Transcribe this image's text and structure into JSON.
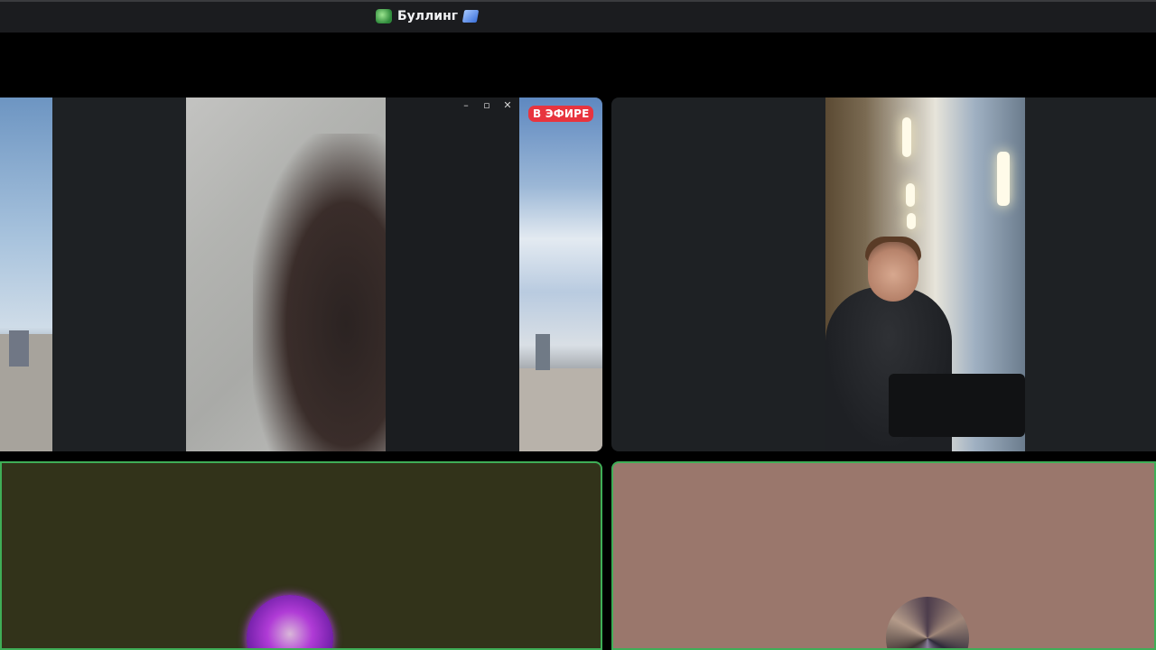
{
  "window": {
    "title": "Буллинг",
    "title_icon": "green-server-icon",
    "title_suffix_icon": "blue-flag-icon"
  },
  "tiles": [
    {
      "type": "screen-share",
      "live_badge": "В ЭФИРЕ",
      "window_controls": [
        "minimize",
        "maximize",
        "close"
      ]
    },
    {
      "type": "camera"
    },
    {
      "type": "avatar",
      "speaking": true,
      "background": "#32331a"
    },
    {
      "type": "avatar",
      "speaking": true,
      "background": "#9a776c"
    }
  ],
  "colors": {
    "speaking_border": "#3fae57",
    "live_badge": "#e8343e",
    "titlebar": "#1b1c1f"
  }
}
